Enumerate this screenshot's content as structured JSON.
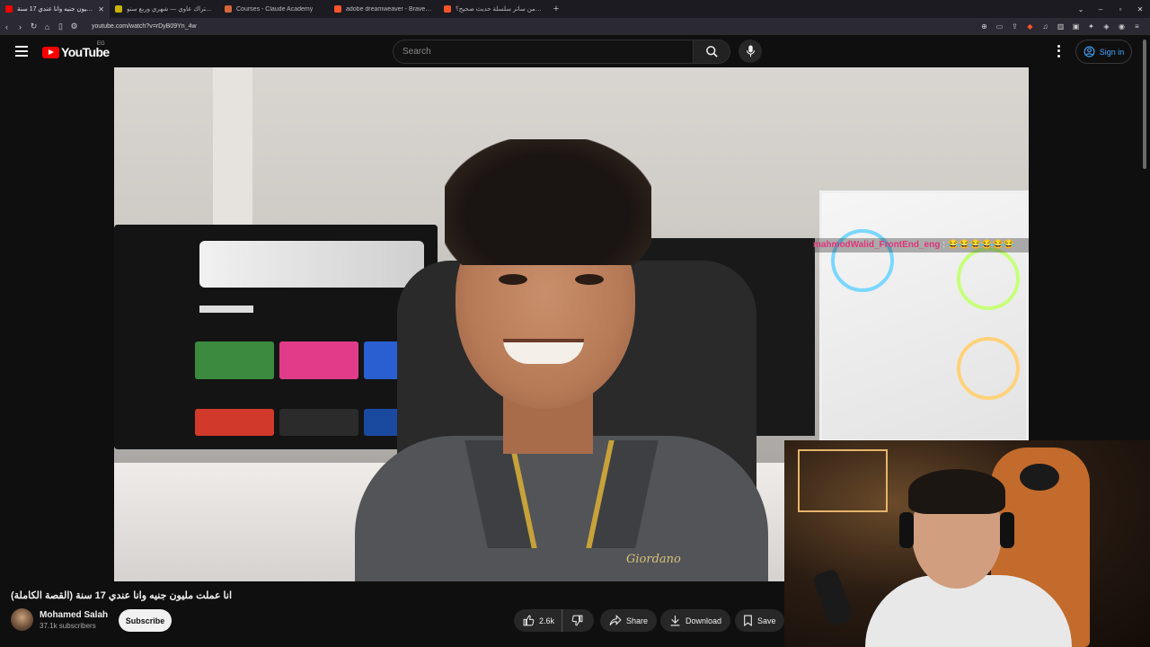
{
  "browser": {
    "tabs": [
      {
        "title": "انا عملت مليون جنيه وانا عندي 17 سنة...",
        "favicon_color": "#ff0000",
        "active": true
      },
      {
        "title": "أسعار اشتراك عاوي — شهري وربع سنو",
        "favicon_color": "#c8b400",
        "active": false
      },
      {
        "title": "Courses - Claude Academy",
        "favicon_color": "#d4663a",
        "active": false
      },
      {
        "title": "adobe dreamweaver - Brave Search",
        "favicon_color": "#fb542b",
        "active": false
      },
      {
        "title": "من ساتر سلسلة حديث صحيح؟ - Search",
        "favicon_color": "#fb542b",
        "active": false
      }
    ],
    "new_tab": "+",
    "url": "youtube.com/watch?v=rDyB09Yn_4w"
  },
  "youtube": {
    "logo_text": "YouTube",
    "country_code": "EG",
    "search_placeholder": "Search",
    "signin_label": "Sign in",
    "brand_red": "#ff0000",
    "link_blue": "#3ea6ff"
  },
  "video": {
    "chat_user": "mahmodWalid_FrontEnd_eng",
    "chat_separator": ":",
    "chat_message": "😂😂😂😂😂😂",
    "shirt_brand": "Giordano",
    "title": "انا عملت مليون جنيه وانا عندي 17 سنة (القصة الكاملة)",
    "channel_name": "Mohamed Salah",
    "subscribers": "37.1k subscribers",
    "subscribe_label": "Subscribe",
    "like_count": "2.6k",
    "share_label": "Share",
    "download_label": "Download",
    "save_label": "Save"
  }
}
